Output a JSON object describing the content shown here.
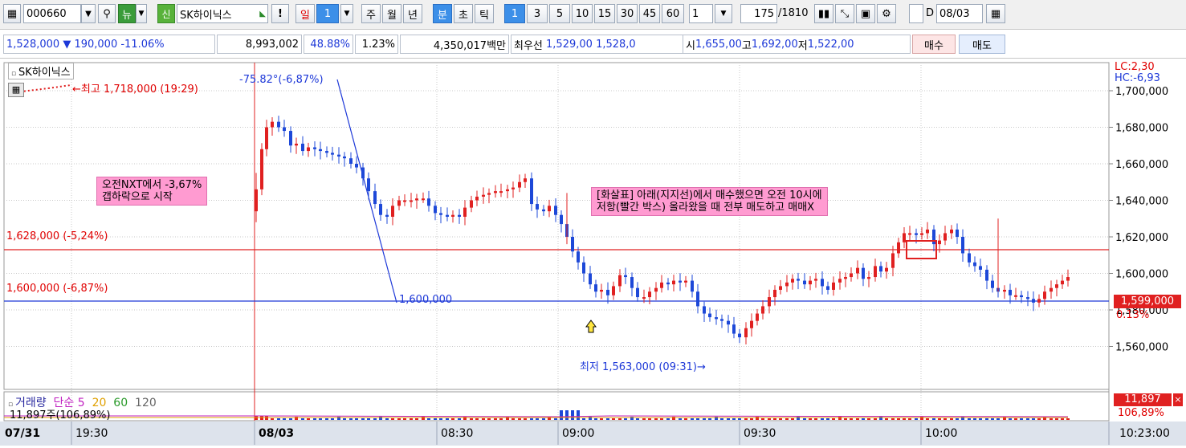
{
  "toolbar": {
    "code": "000660",
    "news_label": "뉴",
    "new_label": "신",
    "stock_name": "SK하이닉스",
    "excl_label": "!",
    "periods": [
      "일",
      "1",
      "주",
      "월",
      "년",
      "분",
      "초",
      "틱"
    ],
    "minutes": [
      "1",
      "3",
      "5",
      "10",
      "15",
      "30",
      "45",
      "60"
    ],
    "count": "1",
    "data_count": "175",
    "data_total": "/1810",
    "d_label": "D",
    "date": "08/03"
  },
  "quote": {
    "price": "1,528,000",
    "change_arrow": "▼",
    "change": "190,000",
    "change_pct": "-11.06%",
    "volume": "8,993,002",
    "rate1": "48.88%",
    "rate2": "1.23%",
    "amount": "4,350,017백만",
    "best_label": "최우선",
    "best_ask": "1,529,00",
    "best_bid": "1,528,0",
    "open_label": "시",
    "open": "1,655,00",
    "high_label": "고",
    "high": "1,692,00",
    "low_label": "저",
    "low": "1,522,00",
    "buy_label": "매수",
    "sell_label": "매도"
  },
  "chart": {
    "legend_name": "SK하이닉스",
    "lc_label": "LC:2,30",
    "hc_label": "HC:-6,93",
    "high_note": "←최고 1,718,000 (19:29)",
    "angle_note": "-75.82°(-6,87%)",
    "trend_end_label": "1,600,000",
    "low_note": "최저 1,563,000 (09:31)",
    "low_arrow": "→",
    "line1_label": "1,628,000 (-5,24%)",
    "line2_label": "1,600,000 (-6,87%)",
    "note1": "오전NXT에서 -3,67%\n갭하락으로 시작",
    "note2": "[화살표] 아래(지지선)에서 매수했으면 오전 10시에\n저항(빨간 박스) 올라왔을 때 전부 매도하고 매매X",
    "last_price_tag": "1,599,000",
    "last_pct": "0.13%",
    "y_ticks": [
      "00",
      "1,700,000",
      "1,680,000",
      "1,660,000",
      "1,640,000",
      "1,620,000",
      "1,600,000",
      "1,580,000",
      "1,560,000"
    ],
    "volume_panel": {
      "title": "거래량",
      "ma_label": "단순",
      "ma_periods": [
        "5",
        "20",
        "60",
        "120"
      ],
      "value_label": "11,897주(106,89%)",
      "tag": "11,897",
      "tag_pct": "106,89%",
      "close_icon": "×"
    },
    "x_ticks": [
      "07/31",
      "19:30",
      "08/03",
      "08:30",
      "09:00",
      "09:30",
      "10:00",
      "10:23:00"
    ],
    "colors": {
      "up": "#e02020",
      "down": "#1d48d8",
      "resistance": "#e02020",
      "support": "#1d38d8",
      "note": "#ff9bd1"
    }
  }
}
